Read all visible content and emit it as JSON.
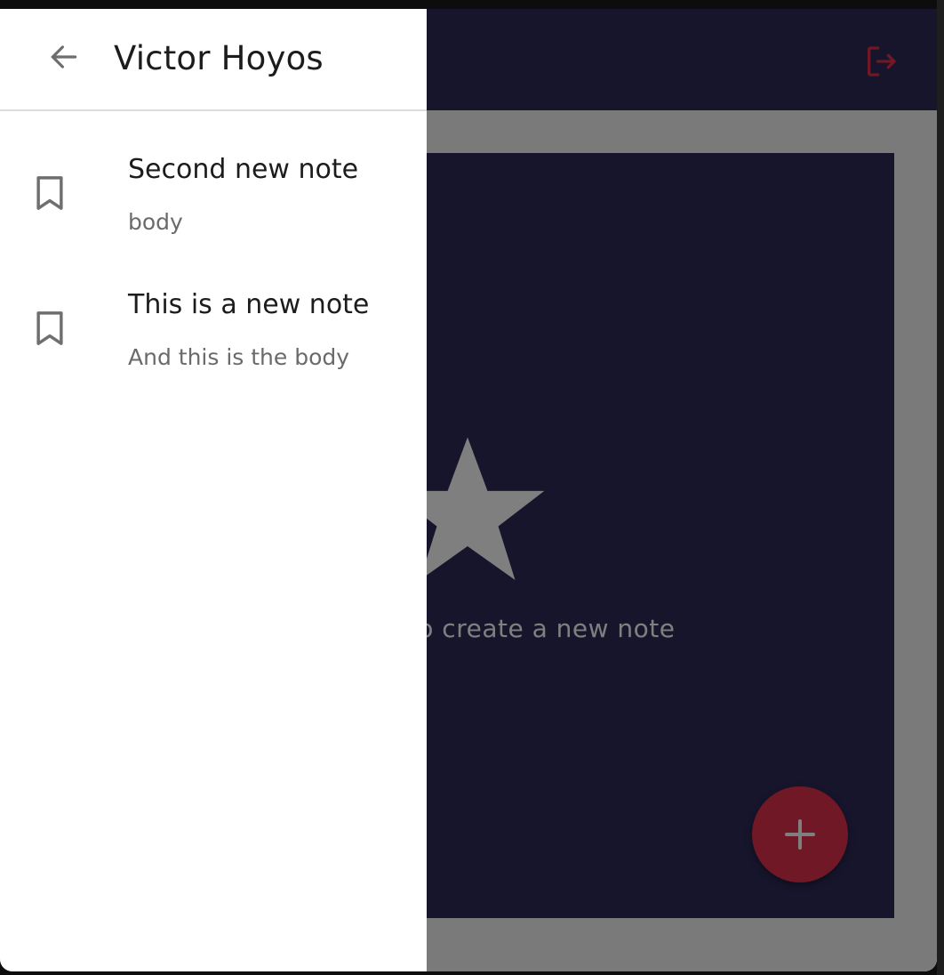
{
  "app": {
    "empty_state_text": "Tap to create a new note",
    "colors": {
      "app_bar": "#2c2a57",
      "accent": "#e0314a",
      "panel": "#2c2a57",
      "scrim": "rgba(0,0,0,0.5)"
    },
    "icons": {
      "logout": "logout-icon",
      "star": "star-icon",
      "add": "plus-icon"
    }
  },
  "drawer": {
    "title": "Victor Hoyos",
    "back_icon": "arrow-back-icon",
    "notes": [
      {
        "title": "Second new note",
        "body": "body",
        "icon": "bookmark-icon"
      },
      {
        "title": "This is a new note",
        "body": "And this is the body",
        "icon": "bookmark-icon"
      }
    ]
  }
}
